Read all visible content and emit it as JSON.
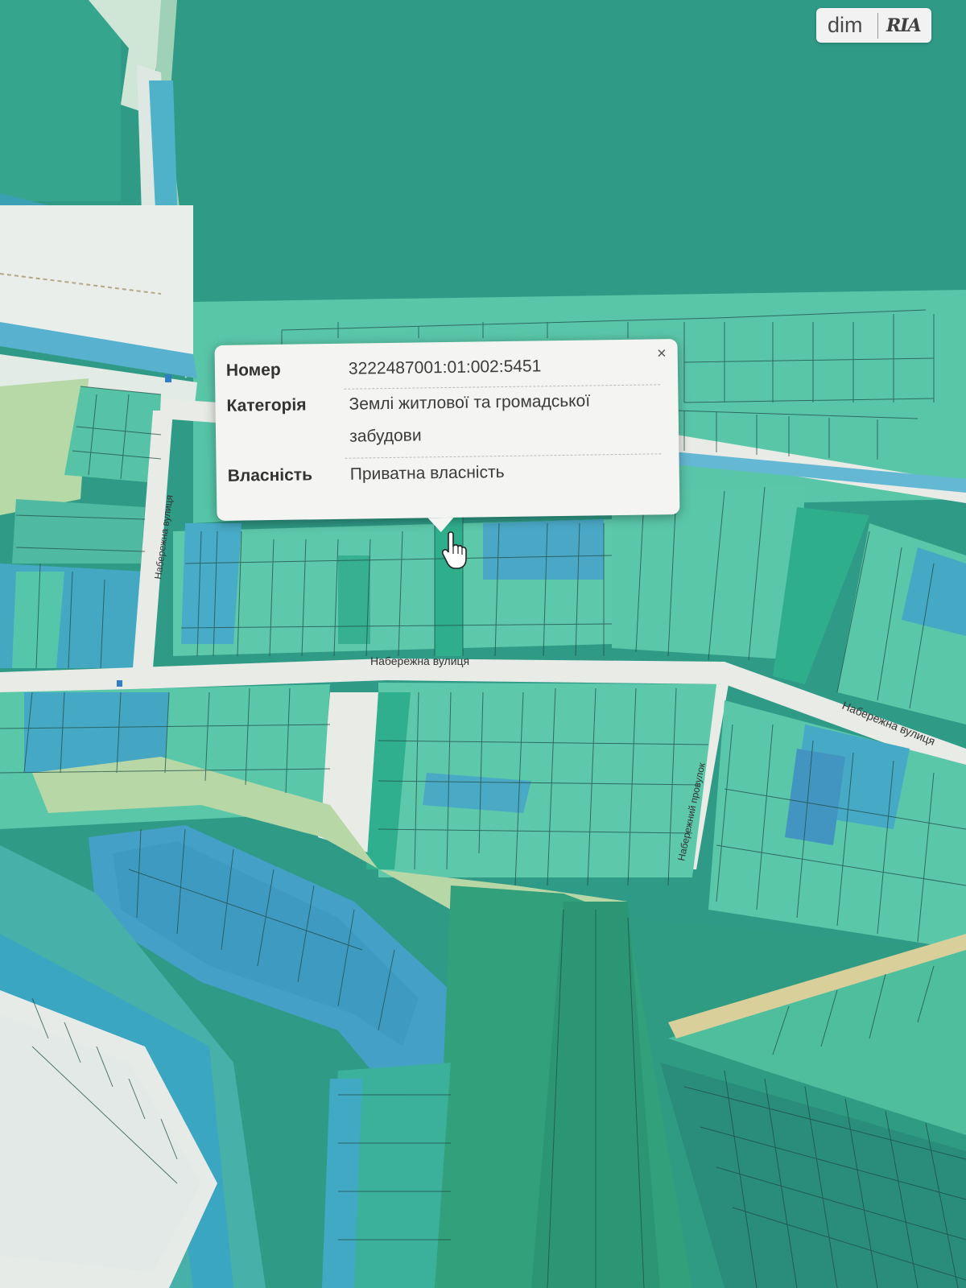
{
  "popup": {
    "rows": [
      {
        "key": "Номер",
        "value": "3222487001:01:002:5451"
      },
      {
        "key": "Категорія",
        "value": "Землі житлової та громадської забудови"
      },
      {
        "key": "Власність",
        "value": "Приватна власність"
      }
    ],
    "close_icon": "×"
  },
  "map": {
    "street_labels": [
      {
        "name": "Набережна вулиця"
      },
      {
        "name": "Набережна вулиця"
      },
      {
        "name": "Набережна вулиця"
      },
      {
        "name": "Набережний провулок"
      }
    ]
  },
  "watermark": {
    "dim": "dim",
    "ria": "RIA"
  },
  "colors": {
    "forest": "#2f9a86",
    "forest_light": "#3ba893",
    "parcel_mint": "#5ccfa9",
    "parcel_teal": "#38b495",
    "parcel_blue": "#4aa4c4",
    "road": "#e8ebe6",
    "meadow": "#b6d6a5"
  }
}
